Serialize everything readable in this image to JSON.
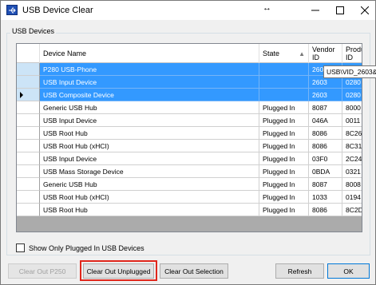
{
  "window": {
    "title": "USB Device Clear",
    "app_icon": "usb-icon",
    "controls": [
      "minimize-icon",
      "maximize-icon",
      "close-icon"
    ]
  },
  "group": {
    "label": "USB Devices"
  },
  "table": {
    "columns": {
      "name": "Device Name",
      "state": "State",
      "vendor": "Vendor ID",
      "product": "Product ID"
    },
    "rows": [
      {
        "name": "P280 USB-Phone",
        "state": "",
        "vendor": "2603",
        "product": "",
        "selected": true
      },
      {
        "name": "USB Input Device",
        "state": "",
        "vendor": "2603",
        "product": "0280",
        "selected": true
      },
      {
        "name": "USB Composite Device",
        "state": "",
        "vendor": "2603",
        "product": "0280",
        "selected": true
      },
      {
        "name": "Generic USB Hub",
        "state": "Plugged In",
        "vendor": "8087",
        "product": "8000",
        "selected": false
      },
      {
        "name": "USB Input Device",
        "state": "Plugged In",
        "vendor": "046A",
        "product": "0011",
        "selected": false
      },
      {
        "name": "USB Root Hub",
        "state": "Plugged In",
        "vendor": "8086",
        "product": "8C26",
        "selected": false
      },
      {
        "name": "USB Root Hub (xHCI)",
        "state": "Plugged In",
        "vendor": "8086",
        "product": "8C31",
        "selected": false
      },
      {
        "name": "USB Input Device",
        "state": "Plugged In",
        "vendor": "03F0",
        "product": "2C24",
        "selected": false
      },
      {
        "name": "USB Mass Storage Device",
        "state": "Plugged In",
        "vendor": "0BDA",
        "product": "0321",
        "selected": false
      },
      {
        "name": "Generic USB Hub",
        "state": "Plugged In",
        "vendor": "8087",
        "product": "8008",
        "selected": false
      },
      {
        "name": "USB Root Hub (xHCI)",
        "state": "Plugged In",
        "vendor": "1033",
        "product": "0194",
        "selected": false
      },
      {
        "name": "USB Root Hub",
        "state": "Plugged In",
        "vendor": "8086",
        "product": "8C2D",
        "selected": false
      }
    ],
    "current_row_index": 2,
    "tooltip": "USB\\VID_2603&"
  },
  "filter": {
    "label": "Show Only Plugged In USB Devices",
    "checked": false
  },
  "buttons": {
    "clear_out_p250": "Clear Out P250",
    "clear_out_unplugged": "Clear Out Unplugged",
    "clear_out_selection": "Clear Out Selection",
    "refresh": "Refresh",
    "ok": "OK"
  },
  "colors": {
    "selection": "#3399ff",
    "highlight_annotation": "#e0261b",
    "default_button_border": "#0078d7"
  }
}
